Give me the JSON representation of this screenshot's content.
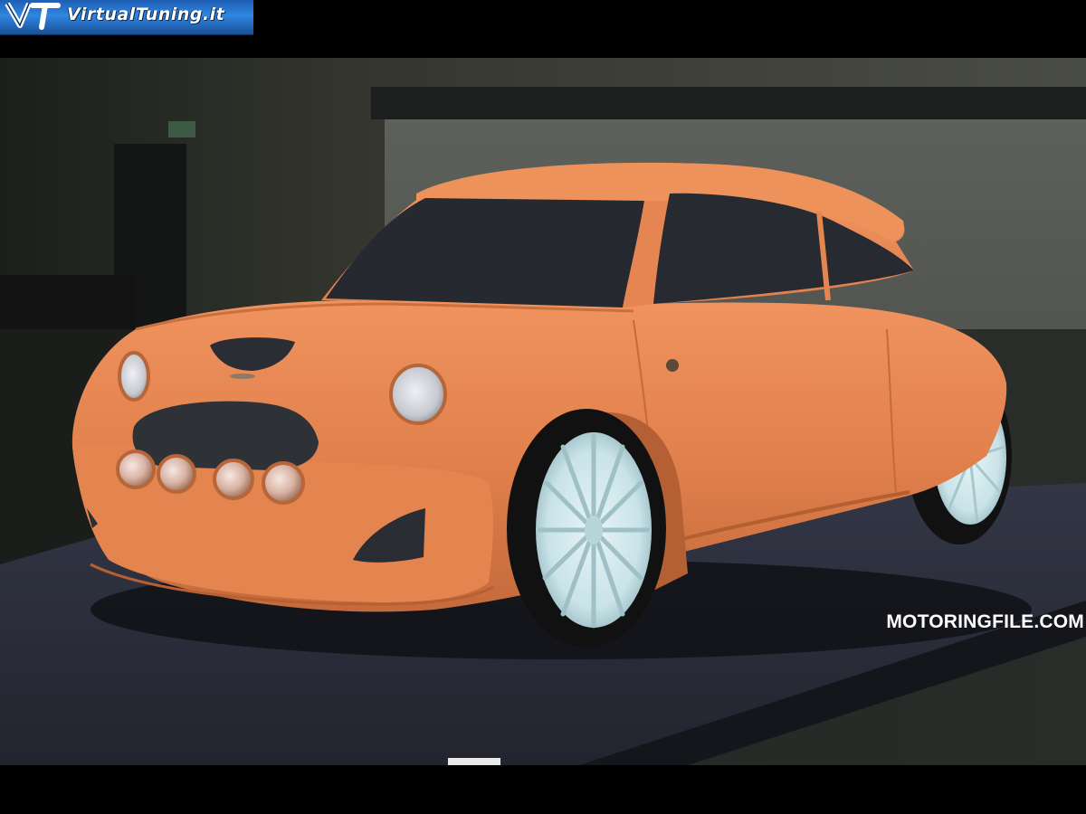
{
  "header": {
    "logo_text": "VirtualTuning.it",
    "logo_icon": "vt-logo-icon"
  },
  "photo": {
    "subject": "car-clay-model",
    "watermark": "MOTORINGFILE.COM"
  },
  "colors": {
    "letterbox": "#000000",
    "clay": "#e2834f",
    "clay_shadow": "#b85f34",
    "glass": "#25292f",
    "wheel": "#cfe6ea",
    "tire": "#111111",
    "platform": "#2c2f3a",
    "wall": "#3a3c38",
    "logo_blue": "#2f86e0"
  }
}
